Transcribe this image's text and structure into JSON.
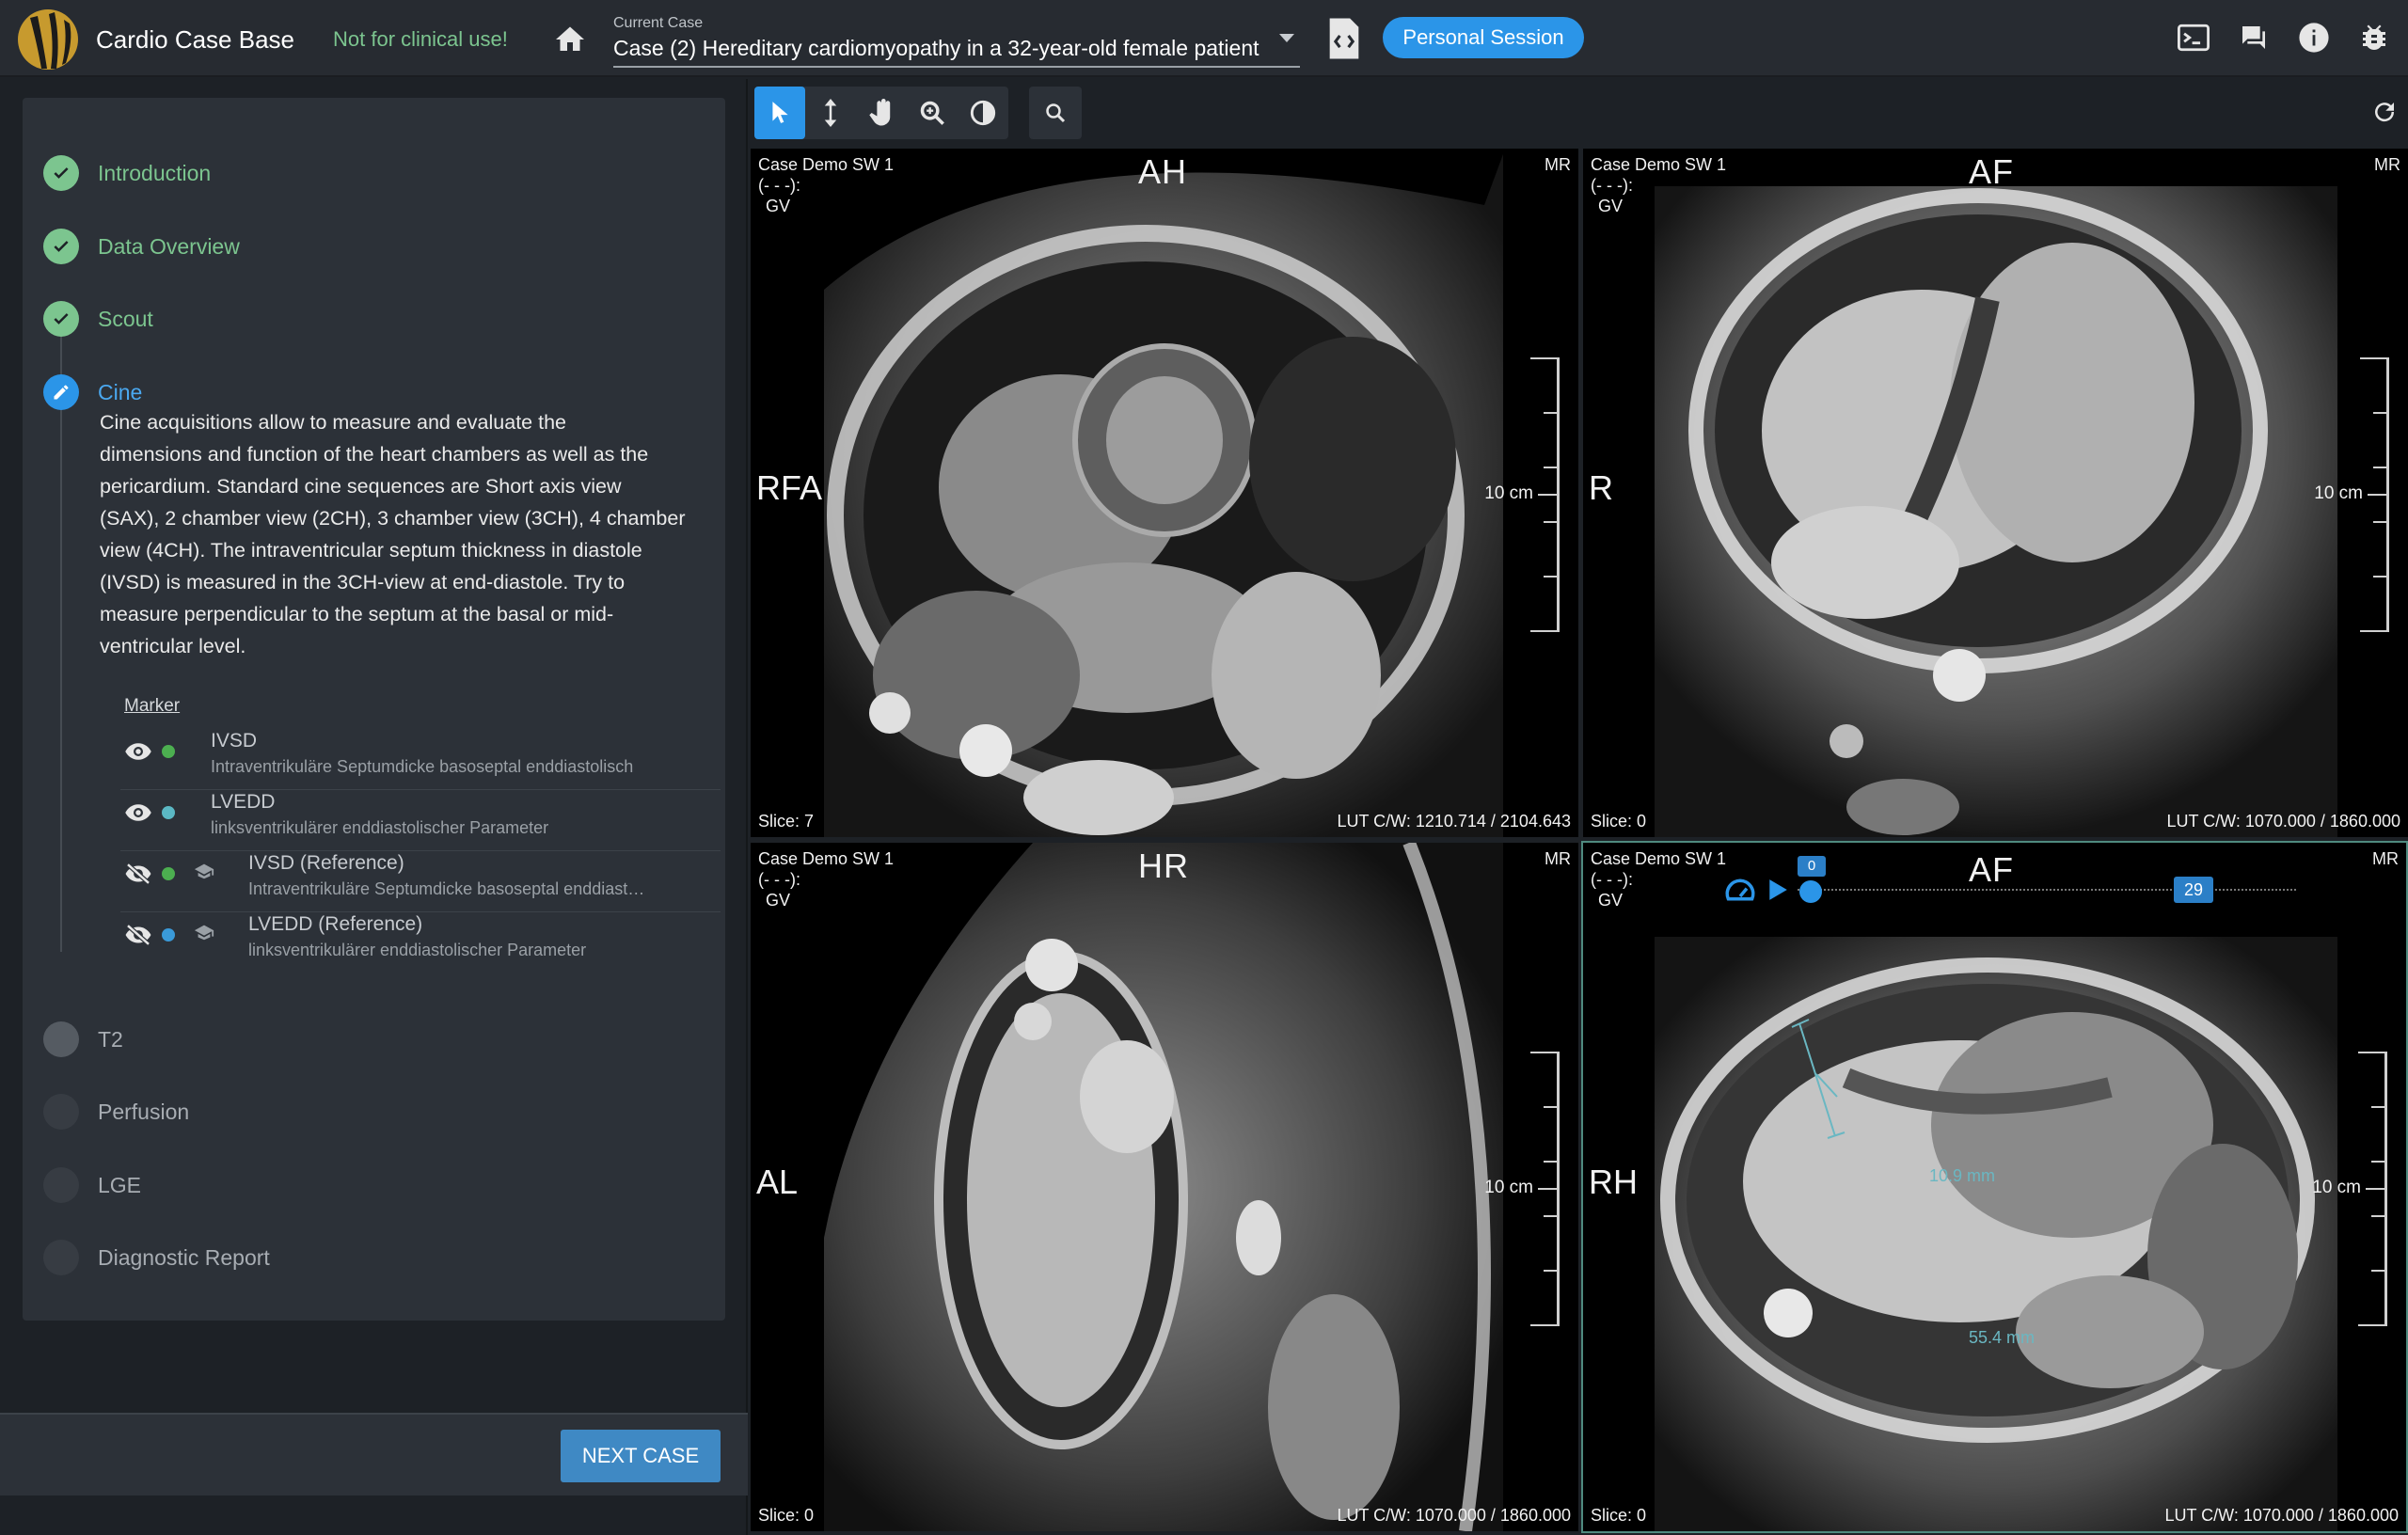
{
  "app": {
    "title": "Cardio Case Base",
    "warning": "Not for clinical use!",
    "current_case_label": "Current Case",
    "current_case_value": "Case (2) Hereditary cardiomyopathy in a 32-year-old female patient",
    "session_button": "Personal Session"
  },
  "steps": [
    {
      "label": "Introduction",
      "state": "done"
    },
    {
      "label": "Data Overview",
      "state": "done"
    },
    {
      "label": "Scout",
      "state": "done"
    },
    {
      "label": "Cine",
      "state": "active"
    },
    {
      "label": "T2",
      "state": "todo"
    },
    {
      "label": "Perfusion",
      "state": "todo"
    },
    {
      "label": "LGE",
      "state": "todo"
    },
    {
      "label": "Diagnostic Report",
      "state": "todo"
    }
  ],
  "cine_description": [
    "Cine acquisitions allow to measure and evaluate the",
    "dimensions and function of the heart chambers as well as the",
    "pericardium. Standard cine sequences are Short axis view",
    "(SAX), 2 chamber view (2CH), 3 chamber view (3CH), 4 chamber",
    "view (4CH). The intraventricular septum thickness in diastole",
    "(IVSD) is measured in the 3CH-view at end-diastole. Try to",
    "measure perpendicular to the septum at the basal or mid-",
    "ventricular level."
  ],
  "marker_heading": "Marker",
  "markers": [
    {
      "title": "IVSD",
      "subtitle": "Intraventrikuläre Septumdicke basoseptal enddiastolisch",
      "visible": true,
      "color": "#4caf50",
      "reference": false
    },
    {
      "title": "LVEDD",
      "subtitle": "linksventrikulärer enddiastolischer Parameter",
      "visible": true,
      "color": "#5bb8c4",
      "reference": false
    },
    {
      "title": "IVSD (Reference)",
      "subtitle": "Intraventrikuläre Septumdicke basoseptal enddiast…",
      "visible": false,
      "color": "#4caf50",
      "reference": true
    },
    {
      "title": "LVEDD (Reference)",
      "subtitle": "linksventrikulärer enddiastolischer Parameter",
      "visible": false,
      "color": "#3a9ad9",
      "reference": true
    }
  ],
  "next_case_button": "NEXT CASE",
  "viewports": [
    {
      "series": "Case Demo SW 1",
      "dash": "(- - -):",
      "gv": "GV",
      "modality": "MR",
      "orient_top": "AH",
      "orient_left": "RFA",
      "scale": "10 cm",
      "slice": "Slice: 7",
      "lut": "LUT C/W: 1210.714 / 2104.643"
    },
    {
      "series": "Case Demo SW 1",
      "dash": "(- - -):",
      "gv": "GV",
      "modality": "MR",
      "orient_top": "AF",
      "orient_left": "R",
      "scale": "10 cm",
      "slice": "Slice: 0",
      "lut": "LUT C/W: 1070.000 / 1860.000"
    },
    {
      "series": "Case Demo SW 1",
      "dash": "(- - -):",
      "gv": "GV",
      "modality": "MR",
      "orient_top": "HR",
      "orient_left": "AL",
      "scale": "10 cm",
      "slice": "Slice: 0",
      "lut": "LUT C/W: 1070.000 / 1860.000"
    },
    {
      "series": "Case Demo SW 1",
      "dash": "(- - -):",
      "gv": "GV",
      "modality": "MR",
      "orient_top": "AF",
      "orient_left": "RH",
      "scale": "10 cm",
      "slice": "Slice: 0",
      "lut": "LUT C/W: 1070.000 / 1860.000"
    }
  ],
  "cine_player": {
    "current_frame": "0",
    "total_frames": "29",
    "progress": 0.0
  },
  "measurements": [
    "10.9 mm",
    "55.4 mm"
  ],
  "colors": {
    "accent": "#2b95e8",
    "done": "#7cc58f",
    "measure": "#6ab7c2",
    "topbar": "#272b31",
    "panel": "#2c3138"
  },
  "icons": [
    "home-icon",
    "code-document-icon",
    "terminal-icon",
    "chat-icon",
    "info-icon",
    "bug-icon",
    "pointer-icon",
    "scroll-icon",
    "pan-icon",
    "zoom-icon",
    "contrast-icon",
    "magnifier-icon",
    "refresh-icon",
    "eye-icon",
    "eye-off-icon",
    "school-cap-icon",
    "speed-icon",
    "play-icon",
    "check-icon",
    "pencil-icon"
  ]
}
